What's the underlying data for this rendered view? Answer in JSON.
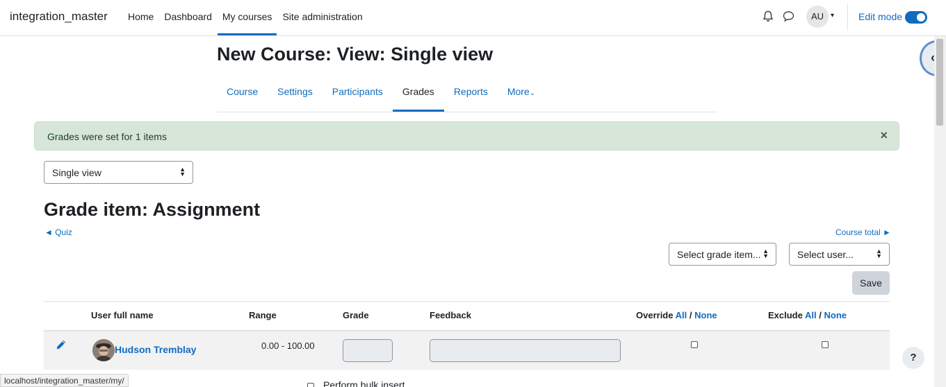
{
  "navbar": {
    "brand": "integration_master",
    "items": [
      {
        "label": "Home"
      },
      {
        "label": "Dashboard"
      },
      {
        "label": "My courses"
      },
      {
        "label": "Site administration"
      }
    ],
    "user_initials": "AU",
    "edit_mode_label": "Edit mode"
  },
  "page": {
    "title": "New Course: View: Single view",
    "tabs": [
      {
        "label": "Course"
      },
      {
        "label": "Settings"
      },
      {
        "label": "Participants"
      },
      {
        "label": "Grades"
      },
      {
        "label": "Reports"
      },
      {
        "label": "More"
      }
    ]
  },
  "alert": {
    "message": "Grades were set for 1 items",
    "close": "×"
  },
  "view_select": {
    "value": "Single view"
  },
  "grade_item": {
    "heading": "Grade item: Assignment",
    "prev_link": "◄ Quiz",
    "next_link": "Course total ►"
  },
  "selectors": {
    "grade_item": "Select grade item...",
    "user": "Select user..."
  },
  "save_label": "Save",
  "table": {
    "headers": {
      "name": "User full name",
      "range": "Range",
      "grade": "Grade",
      "feedback": "Feedback",
      "override": "Override",
      "exclude": "Exclude",
      "all": "All",
      "sep": "/",
      "none": "None"
    },
    "rows": [
      {
        "name": "Hudson Tremblay",
        "range": "0.00 - 100.00",
        "grade": "",
        "feedback": ""
      }
    ]
  },
  "status_url": "localhost/integration_master/my/",
  "bulk_insert": "Perform bulk insert",
  "help": "?",
  "colors": {
    "accent": "#0f6cbf",
    "alert_bg": "#d7e6d8"
  }
}
